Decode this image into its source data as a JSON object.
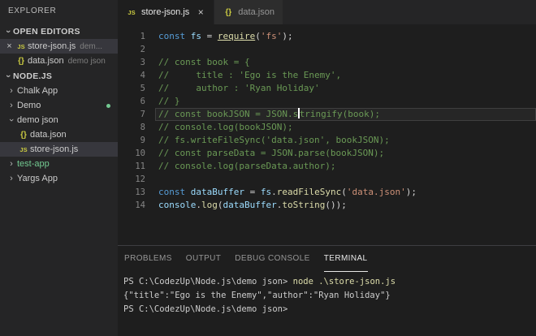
{
  "colors": {
    "sidebar_bg": "#252526",
    "editor_bg": "#1e1e1e",
    "selection_bg": "#37373d",
    "keyword": "#569cd6",
    "variable": "#9cdcfe",
    "function": "#dcdcaa",
    "string": "#ce9178",
    "comment": "#6a9955",
    "file_icon_yellow": "#cbcb41",
    "git_green": "#73c991"
  },
  "sidebar": {
    "title": "EXPLORER",
    "open_editors": {
      "label": "OPEN EDITORS",
      "items": [
        {
          "close": "×",
          "icon": "js",
          "name": "store-json.js",
          "detail": "dem...",
          "active": true
        },
        {
          "close": "",
          "icon": "braces",
          "name": "data.json",
          "detail": "demo json",
          "active": false
        }
      ]
    },
    "project": {
      "label": "NODE.JS",
      "tree": [
        {
          "type": "folder",
          "state": "collapsed",
          "label": "Chalk App",
          "indent": 0
        },
        {
          "type": "folder",
          "state": "collapsed",
          "label": "Demo",
          "indent": 0,
          "dot": true
        },
        {
          "type": "folder",
          "state": "expanded",
          "label": "demo json",
          "indent": 0
        },
        {
          "type": "file",
          "icon": "braces",
          "label": "data.json",
          "indent": 1
        },
        {
          "type": "file",
          "icon": "js",
          "label": "store-json.js",
          "indent": 1,
          "selected": true
        },
        {
          "type": "folder",
          "state": "collapsed",
          "label": "test-app",
          "indent": 0,
          "green": true
        },
        {
          "type": "folder",
          "state": "collapsed",
          "label": "Yargs App",
          "indent": 0
        }
      ]
    }
  },
  "tabs": [
    {
      "icon": "js",
      "label": "store-json.js",
      "close": "×",
      "active": true
    },
    {
      "icon": "braces",
      "label": "data.json",
      "close": "",
      "active": false
    }
  ],
  "editor": {
    "lines": [
      {
        "n": "1",
        "tokens": [
          [
            "const",
            "kw"
          ],
          [
            " ",
            "pl"
          ],
          [
            "fs",
            "var"
          ],
          [
            " ",
            "pl"
          ],
          [
            "=",
            "pl"
          ],
          [
            " ",
            "pl"
          ],
          [
            "require",
            "fnu"
          ],
          [
            "(",
            "pl"
          ],
          [
            "'fs'",
            "str"
          ],
          [
            ");",
            "pl"
          ]
        ]
      },
      {
        "n": "2",
        "tokens": []
      },
      {
        "n": "3",
        "tokens": [
          [
            "// const book = {",
            "com"
          ]
        ]
      },
      {
        "n": "4",
        "tokens": [
          [
            "//     title : 'Ego is the Enemy',",
            "com"
          ]
        ]
      },
      {
        "n": "5",
        "tokens": [
          [
            "//     author : 'Ryan Holiday'",
            "com"
          ]
        ]
      },
      {
        "n": "6",
        "tokens": [
          [
            "// }",
            "com"
          ]
        ]
      },
      {
        "n": "7",
        "current": true,
        "tokens": [
          [
            "// const bookJSON = JSON.s",
            "com"
          ],
          [
            "",
            "caret"
          ],
          [
            "tringify(book);",
            "com"
          ]
        ]
      },
      {
        "n": "8",
        "tokens": [
          [
            "// console.log(bookJSON);",
            "com"
          ]
        ]
      },
      {
        "n": "9",
        "tokens": [
          [
            "// fs.writeFileSync('data.json', bookJSON);",
            "com"
          ]
        ]
      },
      {
        "n": "10",
        "tokens": [
          [
            "// const parseData = JSON.parse(bookJSON);",
            "com"
          ]
        ]
      },
      {
        "n": "11",
        "tokens": [
          [
            "// console.log(parseData.author);",
            "com"
          ]
        ]
      },
      {
        "n": "12",
        "tokens": []
      },
      {
        "n": "13",
        "tokens": [
          [
            "const",
            "kw"
          ],
          [
            " ",
            "pl"
          ],
          [
            "dataBuffer",
            "var"
          ],
          [
            " ",
            "pl"
          ],
          [
            "=",
            "pl"
          ],
          [
            " ",
            "pl"
          ],
          [
            "fs",
            "var"
          ],
          [
            ".",
            "pl"
          ],
          [
            "readFileSync",
            "fn"
          ],
          [
            "(",
            "pl"
          ],
          [
            "'data.json'",
            "str"
          ],
          [
            ");",
            "pl"
          ]
        ]
      },
      {
        "n": "14",
        "tokens": [
          [
            "console",
            "var"
          ],
          [
            ".",
            "pl"
          ],
          [
            "log",
            "fn"
          ],
          [
            "(",
            "pl"
          ],
          [
            "dataBuffer",
            "var"
          ],
          [
            ".",
            "pl"
          ],
          [
            "toString",
            "fn"
          ],
          [
            "());",
            "pl"
          ]
        ]
      }
    ]
  },
  "panel": {
    "tabs": [
      {
        "label": "PROBLEMS",
        "active": false
      },
      {
        "label": "OUTPUT",
        "active": false
      },
      {
        "label": "DEBUG CONSOLE",
        "active": false
      },
      {
        "label": "TERMINAL",
        "active": true
      }
    ],
    "terminal_lines": [
      [
        [
          "PS C:\\CodezUp\\Node.js\\demo json> ",
          "pl"
        ],
        [
          "node .\\store-json.js",
          "cmd"
        ]
      ],
      [
        [
          "{\"title\":\"Ego is the Enemy\",\"author\":\"Ryan Holiday\"}",
          "pl"
        ]
      ],
      [
        [
          "PS C:\\CodezUp\\Node.js\\demo json> ",
          "pl"
        ]
      ]
    ]
  }
}
